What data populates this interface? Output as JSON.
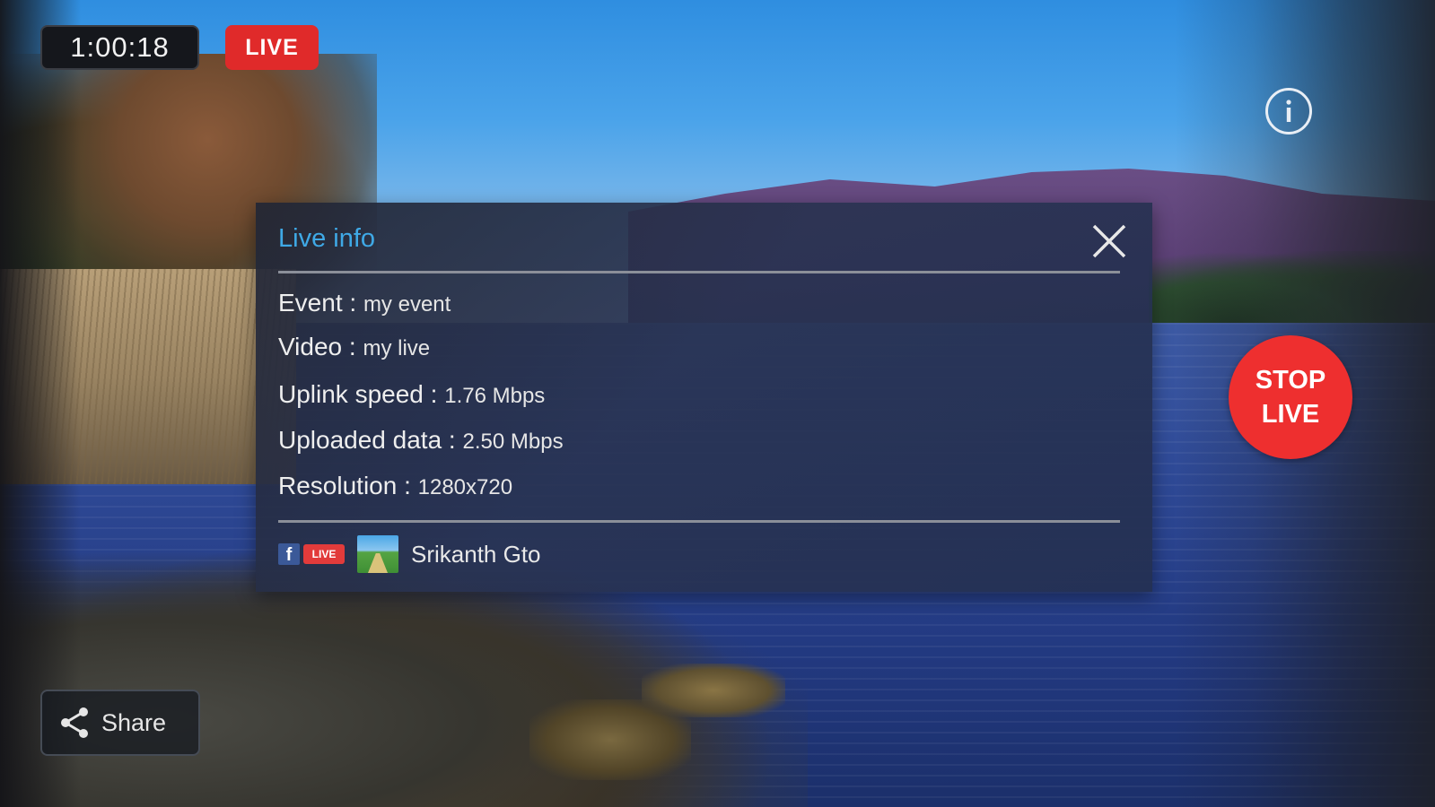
{
  "status_bar": {
    "timer": "1:00:18",
    "live_badge": "LIVE"
  },
  "controls": {
    "info_icon": "info-circle-icon",
    "stop_live_line1": "STOP",
    "stop_live_line2": "LIVE",
    "share_label": "Share",
    "share_icon": "share-icon"
  },
  "live_info": {
    "title": "Live info",
    "close_icon": "close-icon",
    "rows": [
      {
        "label": "Event : ",
        "value": "my event"
      },
      {
        "label": "Video : ",
        "value": "my live"
      },
      {
        "label": "Uplink speed : ",
        "value": "1.76 Mbps"
      },
      {
        "label": "Uploaded data : ",
        "value": "2.50 Mbps"
      },
      {
        "label": "Resolution : ",
        "value": "1280x720"
      }
    ],
    "platform_icon": "facebook-icon",
    "platform_live_tag": "LIVE",
    "user_name": "Srikanth Gto"
  },
  "colors": {
    "accent_title": "#3fa9e6",
    "live_red": "#e02a2a",
    "stop_red": "#ee2f2f"
  }
}
